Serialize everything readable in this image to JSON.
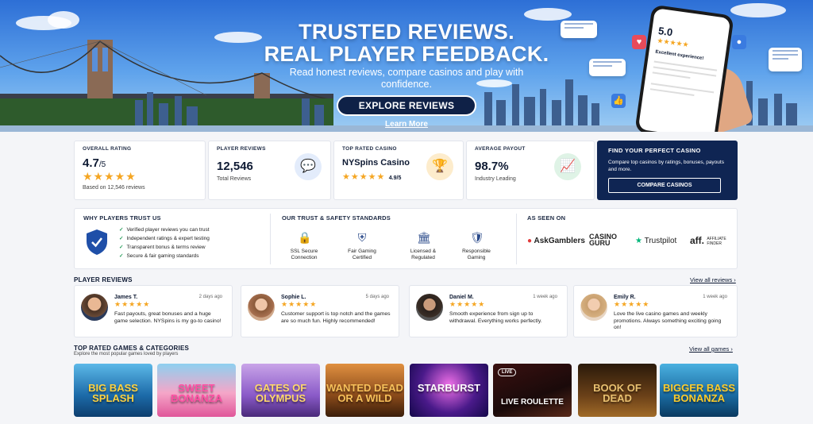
{
  "hero": {
    "title_line1": "TRUSTED REVIEWS.",
    "title_line2": "REAL PLAYER FEEDBACK.",
    "subtitle": "Read honest reviews, compare casinos and play with confidence.",
    "cta_label": "EXPLORE REVIEWS",
    "learn_more": "Learn More",
    "phone": {
      "rating": "5.0",
      "stars": "★★★★★",
      "caption": "Excellent experience!"
    }
  },
  "stats": {
    "overall": {
      "label": "OVERALL RATING",
      "value": "4.7",
      "suffix": "/5",
      "stars": "★★★★★",
      "note": "Based on 12,546 reviews"
    },
    "reviews": {
      "label": "PLAYER REVIEWS",
      "value": "12,546",
      "note": "Total Reviews",
      "icon": "chat-icon"
    },
    "top": {
      "label": "TOP RATED CASINO",
      "value": "NYSpins Casino",
      "stars": "★★★★★",
      "score": "4.9/5",
      "icon": "trophy-icon"
    },
    "payout": {
      "label": "AVERAGE PAYOUT",
      "value": "98.7%",
      "note": "Industry Leading",
      "icon": "trend-icon"
    }
  },
  "find": {
    "title": "FIND YOUR PERFECT CASINO",
    "text": "Compare top casinos by ratings, bonuses, payouts and more.",
    "button": "COMPARE CASINOS"
  },
  "trust": {
    "why_title": "WHY PLAYERS TRUST US",
    "why_items": [
      "Verified player reviews you can trust",
      "Independent ratings & expert testing",
      "Transparent bonus & terms review",
      "Secure & fair gaming standards"
    ],
    "standards_title": "OUR TRUST & SAFETY STANDARDS",
    "standards": [
      {
        "label": "SSL Secure Connection",
        "icon": "lock-icon"
      },
      {
        "label": "Fair Gaming Certified",
        "icon": "shield-star-icon"
      },
      {
        "label": "Licensed & Regulated",
        "icon": "bank-icon"
      },
      {
        "label": "Responsible Gaming",
        "icon": "shield-check-icon"
      }
    ],
    "seen_title": "AS SEEN ON",
    "seen": [
      "AskGamblers",
      "CASINO GURU",
      "Trustpilot",
      "aff.",
      "AFFILIATE FINDER"
    ]
  },
  "reviews": {
    "title": "PLAYER REVIEWS",
    "view_all": "View all reviews ›",
    "items": [
      {
        "name": "James T.",
        "time": "2 days ago",
        "stars": "★★★★★",
        "text": "Fast payouts, great bonuses and a huge game selection. NYSpins is my go-to casino!"
      },
      {
        "name": "Sophie L.",
        "time": "5 days ago",
        "stars": "★★★★★",
        "text": "Customer support is top notch and the games are so much fun. Highly recommended!"
      },
      {
        "name": "Daniel M.",
        "time": "1 week ago",
        "stars": "★★★★★",
        "text": "Smooth experience from sign up to withdrawal. Everything works perfectly."
      },
      {
        "name": "Emily R.",
        "time": "1 week ago",
        "stars": "★★★★★",
        "text": "Love the live casino games and weekly promotions. Always something exciting going on!"
      }
    ]
  },
  "games": {
    "title": "TOP RATED GAMES & CATEGORIES",
    "subtitle": "Explore the most popular games loved by players",
    "view_all": "View all games ›",
    "items": [
      "BIG BASS SPLASH",
      "SWEET BONANZA",
      "GATES OF OLYMPUS",
      "WANTED DEAD OR A WILD",
      "STARBURST",
      "LIVE ROULETTE",
      "BOOK OF DEAD",
      "BIGGER BASS BONANZA"
    ],
    "live_badge": "LIVE"
  },
  "colors": {
    "navy": "#0f2553",
    "star": "#f5a623",
    "check": "#2a9d5c"
  }
}
